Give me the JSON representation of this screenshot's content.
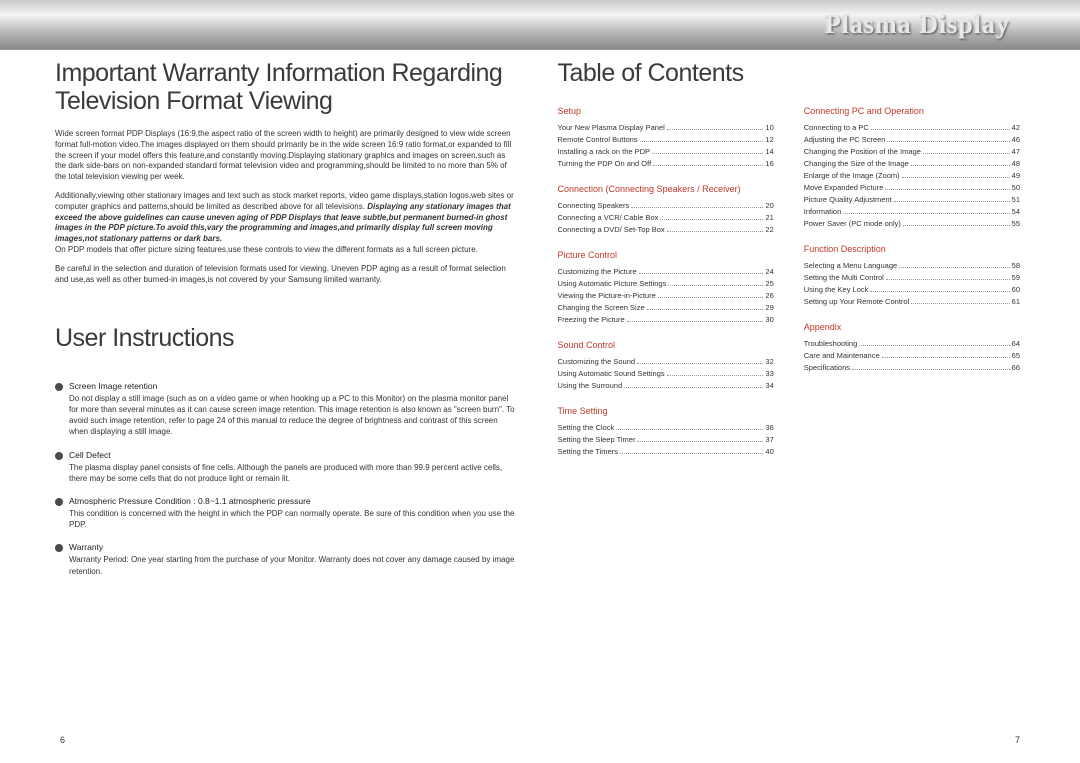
{
  "brand_header": "Plasma Display",
  "left": {
    "title1": "Important Warranty Information Regarding Television Format Viewing",
    "para1": "Wide screen format PDP Displays (16:9,the aspect ratio of the screen width to height) are primarily designed to view wide screen format full-motion video.The images displayed on them should primarily be in the wide screen 16:9 ratio format,or expanded to fill the screen if your model offers this feature,and constantly moving.Displaying stationary graphics and images on screen,such as the dark side-bars on non-expanded standard format television video and programming,should be limited to no more than 5% of the total television viewing per week.",
    "para2a": "Additionally,viewing other stationary images and text such as stock market reports, video game displays,station logos,web sites or computer graphics and patterns,should be limited as described above for all televisions.",
    "para2b": "Displaying any stationary images that exceed the above guidelines can cause uneven aging of PDP Displays that leave subtle,but permanent burned-in ghost images in the PDP picture.To avoid this,vary the programming and images,and primarily display full screen moving images,not stationary patterns or dark bars.",
    "para2c": "On PDP models that offer picture sizing features,use these controls to view the different formats as a full screen picture.",
    "para3": "Be careful in the selection and duration of television formats used for viewing. Uneven PDP aging as a result of format selection and use,as well as other burned-in images,is not covered by your Samsung limited warranty.",
    "title2": "User Instructions",
    "bullets": [
      {
        "title": "Screen Image retention",
        "body": "Do not display a still image (such as on a video game or when hooking up a PC to this Monitor) on the plasma monitor panel for more than several minutes as it can cause screen image retention. This image retention is also known as \"screen burn\". To avoid such image retention, refer to page 24 of this manual to reduce the degree of brightness and contrast of this screen when displaying a still image."
      },
      {
        "title": "Cell Defect",
        "body": "The plasma display panel consists of fine cells. Although the panels are produced with more than 99.9 percent active cells, there may be some cells that do not produce light or remain lit."
      },
      {
        "title": "Atmospheric Pressure Condition : 0.8~1.1 atmospheric pressure",
        "body": "This condition is concerned with the height in which the PDP can normally operate. Be sure of this condition when you use the PDP."
      },
      {
        "title": "Warranty",
        "body": "Warranty Period: One year starting from the purchase of your Monitor.\nWarranty does not cover any damage caused by image retention."
      }
    ],
    "page_num": "6"
  },
  "right": {
    "title": "Table of Contents",
    "sections_col1": [
      {
        "heading": "Setup",
        "items": [
          {
            "label": "Your New Plasma Display Panel",
            "pg": "10"
          },
          {
            "label": "Remote Control Buttons",
            "pg": "12"
          },
          {
            "label": "Installing a rack on the PDP",
            "pg": "14"
          },
          {
            "label": "Turning the PDP On and Off",
            "pg": "16"
          }
        ]
      },
      {
        "heading": "Connection (Connecting Speakers / Receiver)",
        "items": [
          {
            "label": "Connecting Speakers",
            "pg": "20"
          },
          {
            "label": "Connecting a VCR/ Cable Box",
            "pg": "21"
          },
          {
            "label": "Connecting a DVD/ Set-Top Box",
            "pg": "22"
          }
        ]
      },
      {
        "heading": "Picture Control",
        "items": [
          {
            "label": "Customizing the Picture",
            "pg": "24"
          },
          {
            "label": "Using Automatic Picture Settings",
            "pg": "25"
          },
          {
            "label": "Viewing the Picture-in-Picture",
            "pg": "26"
          },
          {
            "label": "Changing the Screen Size",
            "pg": "29"
          },
          {
            "label": "Freezing the Picture",
            "pg": "30"
          }
        ]
      },
      {
        "heading": "Sound Control",
        "items": [
          {
            "label": "Customizing the Sound",
            "pg": "32"
          },
          {
            "label": "Using Automatic Sound Settings",
            "pg": "33"
          },
          {
            "label": "Using the Surround",
            "pg": "34"
          }
        ]
      },
      {
        "heading": "Time Setting",
        "items": [
          {
            "label": "Setting the Clock",
            "pg": "36"
          },
          {
            "label": "Setting the Sleep Timer",
            "pg": "37"
          },
          {
            "label": "Setting the Timers",
            "pg": "40"
          }
        ]
      }
    ],
    "sections_col2": [
      {
        "heading": "Connecting PC and Operation",
        "items": [
          {
            "label": "Connecting to a PC",
            "pg": "42"
          },
          {
            "label": "Adjusting the PC Screen",
            "pg": "46"
          },
          {
            "label": "Changing the Position of the Image",
            "pg": "47"
          },
          {
            "label": "Changing the Size of the Image",
            "pg": "48"
          },
          {
            "label": "Enlarge of the Image (Zoom)",
            "pg": "49"
          },
          {
            "label": "Move Expanded Picture",
            "pg": "50"
          },
          {
            "label": "Picture Quality Adjustment",
            "pg": "51"
          },
          {
            "label": "Information",
            "pg": "54"
          },
          {
            "label": "Power Saver (PC mode only)",
            "pg": "55"
          }
        ]
      },
      {
        "heading": "Function Description",
        "items": [
          {
            "label": "Selecting a Menu Language",
            "pg": "58"
          },
          {
            "label": "Setting the Multi Control",
            "pg": "59"
          },
          {
            "label": "Using the Key Lock",
            "pg": "60"
          },
          {
            "label": "Setting up Your Remote Control",
            "pg": "61"
          }
        ]
      },
      {
        "heading": "Appendix",
        "items": [
          {
            "label": "Troubleshooting",
            "pg": "64"
          },
          {
            "label": "Care and Maintenance",
            "pg": "65"
          },
          {
            "label": "Specifications",
            "pg": "66"
          }
        ]
      }
    ],
    "page_num": "7"
  }
}
